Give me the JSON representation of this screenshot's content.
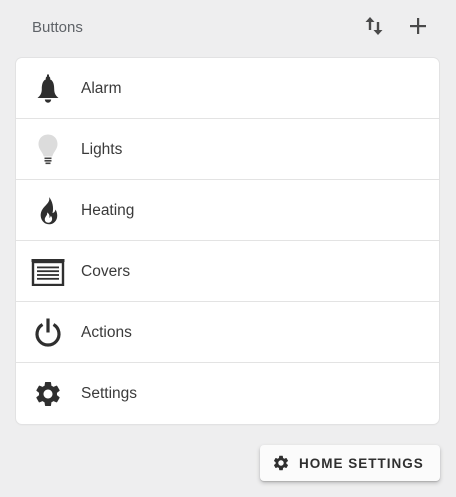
{
  "header": {
    "title": "Buttons",
    "sort_icon": "swap-vertical-icon",
    "add_icon": "plus-icon"
  },
  "items": [
    {
      "label": "Alarm",
      "icon": "bell-icon"
    },
    {
      "label": "Lights",
      "icon": "lightbulb-icon"
    },
    {
      "label": "Heating",
      "icon": "fire-icon"
    },
    {
      "label": "Covers",
      "icon": "blinds-icon"
    },
    {
      "label": "Actions",
      "icon": "power-icon"
    },
    {
      "label": "Settings",
      "icon": "gear-icon"
    }
  ],
  "home_settings": {
    "label": "HOME SETTINGS",
    "icon": "gear-icon"
  },
  "colors": {
    "background": "#eeeeef",
    "card": "#ffffff",
    "icon_dark": "#2f2f2f",
    "icon_light": "#dcdcdc"
  }
}
